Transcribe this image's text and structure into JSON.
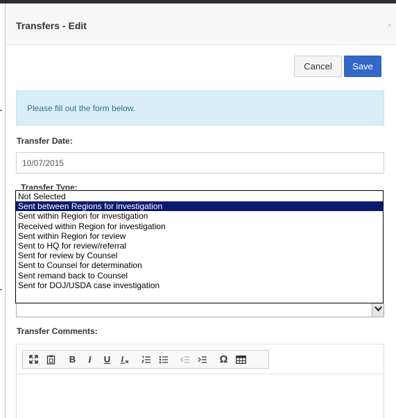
{
  "modal": {
    "title": "Transfers - Edit",
    "close_label": "×",
    "cancel_label": "Cancel",
    "save_label": "Save",
    "alert_text": "Please fill out the form below."
  },
  "fields": {
    "transfer_date_label": "Transfer Date:",
    "transfer_date_value": "10/07/2015",
    "transfer_type_label": "Transfer Type:",
    "transfer_comments_label": "Transfer Comments:"
  },
  "transfer_type_options": [
    "Not Selected",
    "Sent between Regions for investigation",
    "Sent within Region for investigation",
    "Received within Region for investigation",
    "Sent within Region for review",
    "Sent to HQ for review/referral",
    "Sent for review by Counsel",
    "Sent to Counsel for determination",
    "Sent remand back to Counsel",
    "Sent for DOJ/USDA case investigation"
  ],
  "transfer_type_highlighted": "Sent between Regions for investigation",
  "toolbar_icons": [
    "maximize-icon",
    "paste-from-word-icon",
    "bold-icon",
    "italic-icon",
    "underline-icon",
    "remove-format-icon",
    "numbered-list-icon",
    "bulleted-list-icon",
    "outdent-icon",
    "indent-icon",
    "special-character-icon",
    "table-icon"
  ],
  "toolbar_text": {
    "bold": "B",
    "italic": "I",
    "underline": "U",
    "omega": "Ω"
  },
  "colors": {
    "primary": "#3367c8",
    "alert_bg": "#d9edf7",
    "highlight": "#0c1a6e"
  }
}
